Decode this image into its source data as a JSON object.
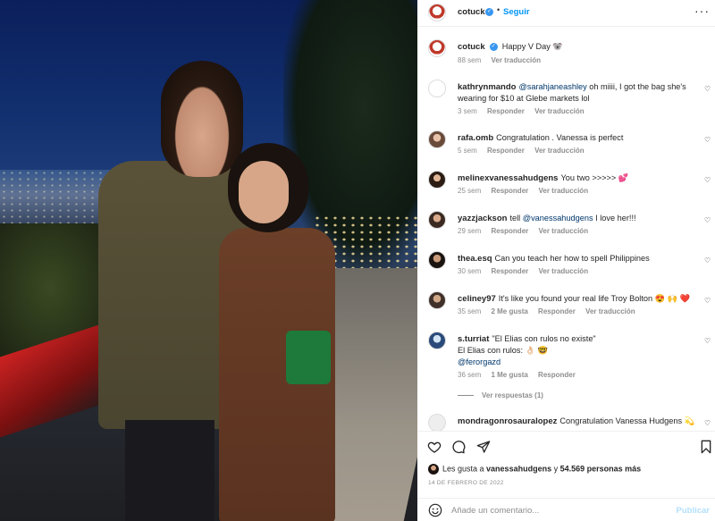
{
  "post": {
    "username": "cotuck",
    "verified_mark": "✓",
    "dot": "•",
    "follow_label": "Seguir",
    "more_label": "···",
    "caption": "Happy V Day 🐨",
    "caption_time": "88 sem",
    "caption_translate": "Ver traducción"
  },
  "comments": [
    {
      "user": "kathrynmando",
      "mention": "@sarahjaneashley",
      "text": " oh miiii, I got the bag she's wearing for $10 at Glebe markets lol",
      "time": "3 sem",
      "reply": "Responder",
      "translate": "Ver traducción"
    },
    {
      "user": "rafa.omb",
      "text": "Congratulation . Vanessa is perfect",
      "time": "5 sem",
      "reply": "Responder",
      "translate": "Ver traducción"
    },
    {
      "user": "melinexvanessahudgens",
      "text": "You two >>>>> 💕",
      "time": "25 sem",
      "reply": "Responder",
      "translate": "Ver traducción"
    },
    {
      "user": "yazzjackson",
      "text": "tell ",
      "mention": "@vanessahudgens",
      "text_after": " I love her!!!",
      "time": "29 sem",
      "reply": "Responder",
      "translate": "Ver traducción"
    },
    {
      "user": "thea.esq",
      "text": "Can you teach her how to spell Philippines",
      "time": "30 sem",
      "reply": "Responder",
      "translate": "Ver traducción"
    },
    {
      "user": "celiney97",
      "text": "It's like you found your real life Troy Bolton 😍 🙌 ❤️",
      "time": "35 sem",
      "likes": "2 Me gusta",
      "reply": "Responder",
      "translate": "Ver traducción"
    },
    {
      "user": "s.turriat",
      "text": "\"El Elias con rulos no existe\"",
      "line2": "El Elias con rulos: 👌🏻 🤓",
      "mention": "@ferorgazd",
      "time": "36 sem",
      "likes": "1 Me gusta",
      "reply": "Responder",
      "view_replies": "Ver respuestas (1)"
    },
    {
      "user": "mondragonrosauralopez",
      "text": "Congratulation Vanessa Hudgens 💫"
    }
  ],
  "footer": {
    "likes_prefix": "Les gusta a ",
    "likes_user": "vanessahudgens",
    "likes_mid": " y ",
    "likes_count": "54.569 personas más",
    "date": "14 DE FEBRERO DE 2022",
    "comment_placeholder": "Añade un comentario...",
    "post_label": "Publicar"
  },
  "colors": {
    "accent": "#0095f6",
    "verified": "#3897f0",
    "muted": "#8e8e8e",
    "text": "#262626"
  },
  "icons": [
    "heart-icon",
    "comment-icon",
    "share-icon",
    "bookmark-icon",
    "emoji-icon",
    "more-icon"
  ]
}
